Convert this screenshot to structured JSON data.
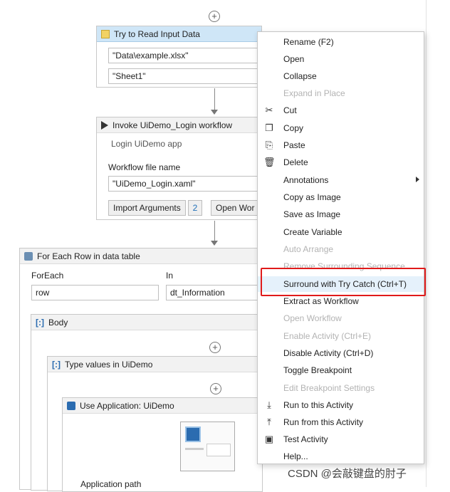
{
  "workflow": {
    "read_input": {
      "title": "Try to Read Input Data",
      "path_value": "\"Data\\example.xlsx\"",
      "sheet_value": "\"Sheet1\""
    },
    "invoke": {
      "title": "Invoke UiDemo_Login workflow",
      "description": "Login UiDemo app",
      "file_label": "Workflow file name",
      "file_value": "\"UiDemo_Login.xaml\"",
      "import_label": "Import Arguments",
      "import_count": "2",
      "open_label": "Open Wor"
    },
    "for_each": {
      "title": "For Each Row in data table",
      "foreach_label": "ForEach",
      "foreach_value": "row",
      "in_label": "In",
      "in_value": "dt_Information"
    },
    "body": {
      "title": "Body"
    },
    "type_values": {
      "title": "Type values in UiDemo"
    },
    "use_app": {
      "title": "Use Application: UiDemo",
      "path_label": "Application path"
    }
  },
  "context_menu": {
    "items": [
      {
        "label": "Rename (F2)",
        "enabled": true,
        "icon": ""
      },
      {
        "label": "Open",
        "enabled": true,
        "icon": ""
      },
      {
        "label": "Collapse",
        "enabled": true,
        "icon": ""
      },
      {
        "label": "Expand in Place",
        "enabled": false,
        "icon": ""
      },
      {
        "label": "Cut",
        "enabled": true,
        "icon": "scissors-icon"
      },
      {
        "label": "Copy",
        "enabled": true,
        "icon": "copy-icon"
      },
      {
        "label": "Paste",
        "enabled": true,
        "icon": "paste-icon"
      },
      {
        "label": "Delete",
        "enabled": true,
        "icon": "trash-icon"
      },
      {
        "label": "Annotations",
        "enabled": true,
        "icon": "",
        "submenu": true
      },
      {
        "label": "Copy as Image",
        "enabled": true,
        "icon": ""
      },
      {
        "label": "Save as Image",
        "enabled": true,
        "icon": ""
      },
      {
        "label": "Create Variable",
        "enabled": true,
        "icon": ""
      },
      {
        "label": "Auto Arrange",
        "enabled": false,
        "icon": ""
      },
      {
        "label": "Remove Surrounding Sequence",
        "enabled": false,
        "icon": ""
      },
      {
        "label": "Surround with Try Catch (Ctrl+T)",
        "enabled": true,
        "icon": "",
        "hover": true
      },
      {
        "label": "Extract as Workflow",
        "enabled": true,
        "icon": ""
      },
      {
        "label": "Open Workflow",
        "enabled": false,
        "icon": ""
      },
      {
        "label": "Enable Activity (Ctrl+E)",
        "enabled": false,
        "icon": ""
      },
      {
        "label": "Disable Activity (Ctrl+D)",
        "enabled": true,
        "icon": ""
      },
      {
        "label": "Toggle Breakpoint",
        "enabled": true,
        "icon": ""
      },
      {
        "label": "Edit Breakpoint Settings",
        "enabled": false,
        "icon": ""
      },
      {
        "label": "Run to this Activity",
        "enabled": true,
        "icon": "run-to-icon"
      },
      {
        "label": "Run from this Activity",
        "enabled": true,
        "icon": "run-from-icon"
      },
      {
        "label": "Test Activity",
        "enabled": true,
        "icon": "test-icon"
      },
      {
        "label": "Help...",
        "enabled": true,
        "icon": ""
      }
    ]
  },
  "watermark": "CSDN @会敲键盘的肘子",
  "colors": {
    "highlight": "#e01b1b",
    "selected_header": "#cfe6f7",
    "accent": "#2b6cb0"
  }
}
